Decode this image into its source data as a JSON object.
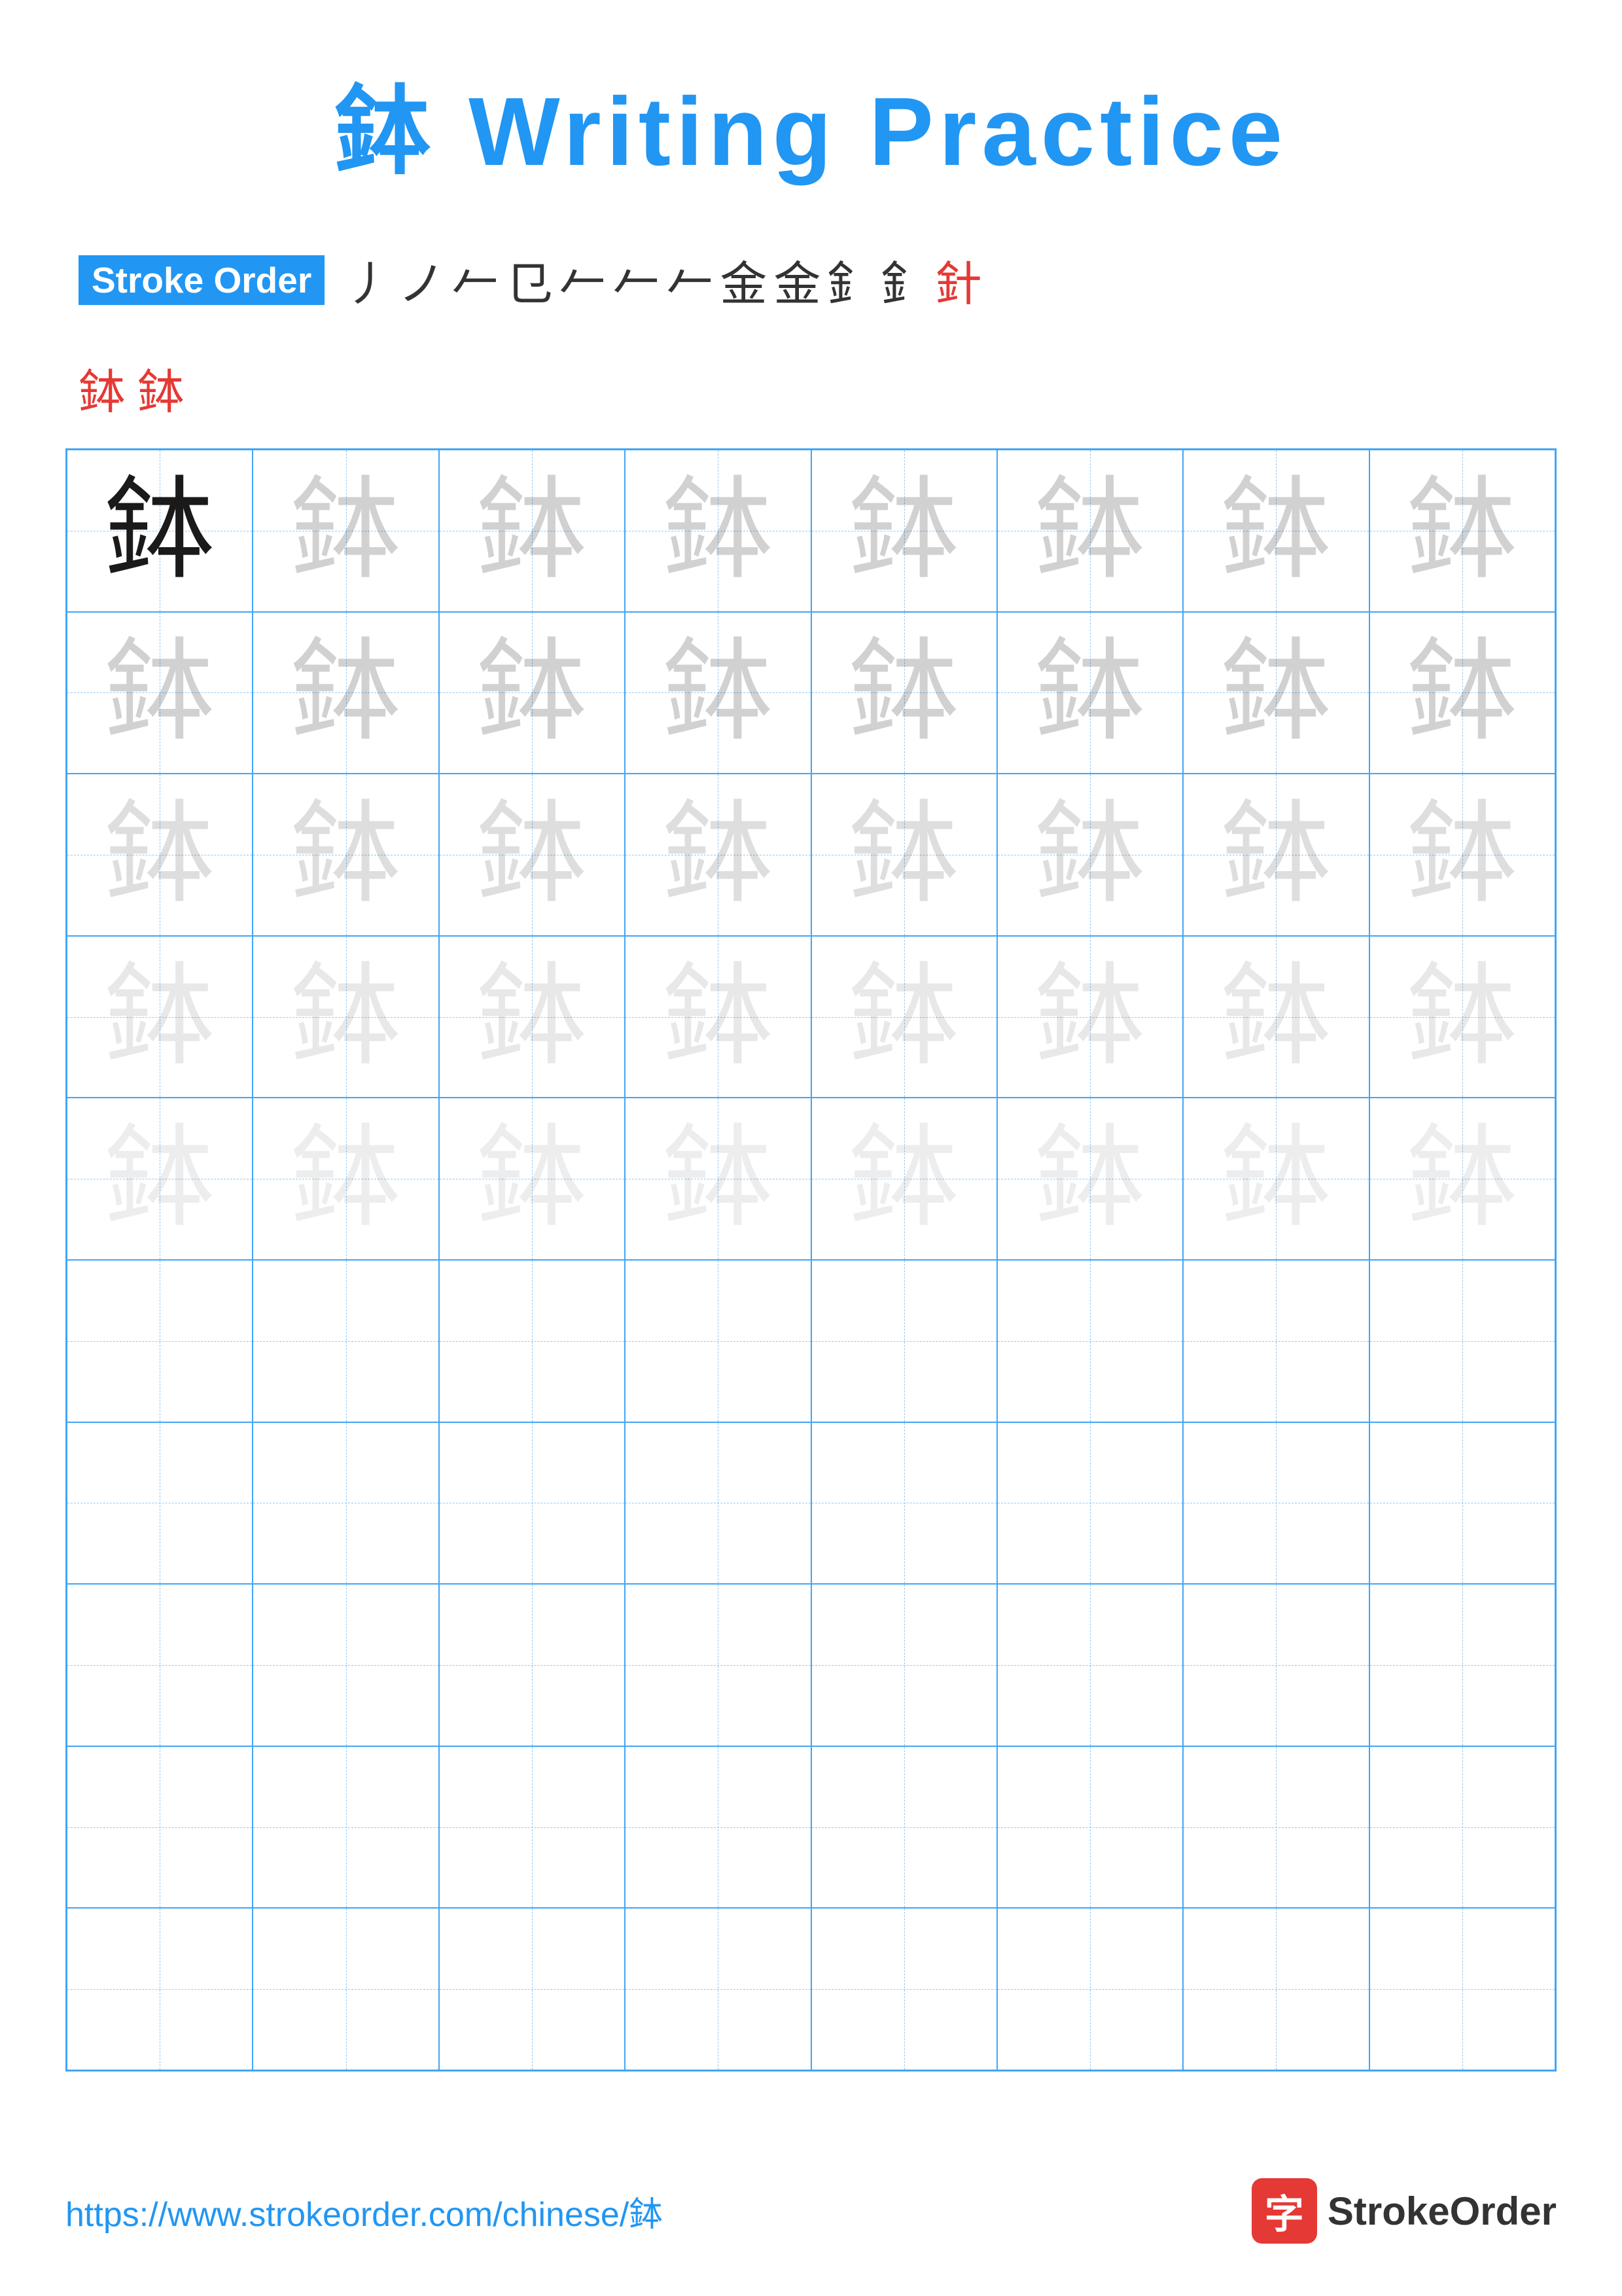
{
  "title": {
    "character": "鉢",
    "text": " Writing Practice"
  },
  "stroke_order": {
    "label": "Stroke Order",
    "strokes": [
      "丿",
      "ノ",
      "𠂉",
      "㔾",
      "𠂉",
      "𠂉",
      "𠂉",
      "金",
      "金",
      "釒",
      "釒",
      "針"
    ],
    "line2": [
      "鉢",
      "鉢"
    ]
  },
  "grid": {
    "character": "鉢",
    "rows": 10,
    "cols": 8
  },
  "footer": {
    "url": "https://www.strokeorder.com/chinese/鉢",
    "logo_text": "StrokeOrder"
  }
}
